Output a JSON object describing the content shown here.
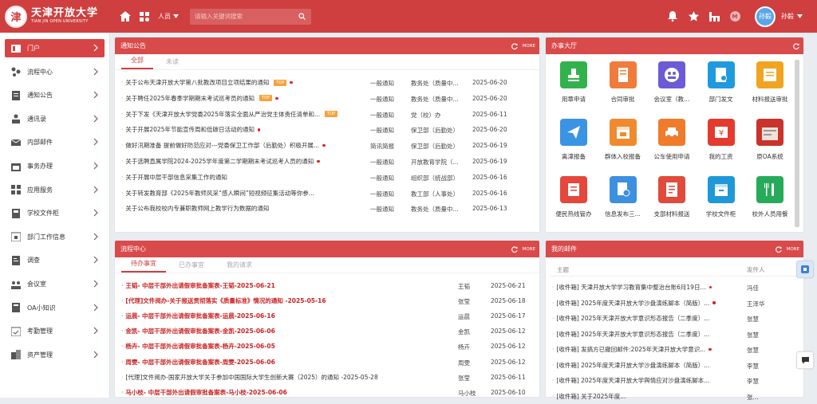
{
  "brand": {
    "title_cn": "天津开放大学",
    "title_en": "TIAN JIN OPEN UNIVERSITY",
    "seal": "津"
  },
  "search": {
    "scope": "人员",
    "placeholder": "请输入关键词搜索"
  },
  "user": {
    "avatar_text": "孙毅",
    "name": "孙毅"
  },
  "topbar_badge": "M",
  "colors": {
    "primary": "#cf3f3f",
    "panel_head": "#d94a4a",
    "badge": "#f7a23b"
  },
  "sidebar": {
    "items": [
      {
        "label": "门户",
        "icon": "portal-icon"
      },
      {
        "label": "流程中心",
        "icon": "flow-icon"
      },
      {
        "label": "通知公告",
        "icon": "notice-icon"
      },
      {
        "label": "通讯录",
        "icon": "contacts-icon"
      },
      {
        "label": "内部邮件",
        "icon": "mail-icon"
      },
      {
        "label": "事务办理",
        "icon": "calendar-icon"
      },
      {
        "label": "应用服务",
        "icon": "apps-icon"
      },
      {
        "label": "学校文件柜",
        "icon": "cabinet-icon"
      },
      {
        "label": "部门工作信息",
        "icon": "dept-calendar-icon"
      },
      {
        "label": "调查",
        "icon": "survey-icon"
      },
      {
        "label": "会议室",
        "icon": "meeting-icon"
      },
      {
        "label": "OA小知识",
        "icon": "knowledge-icon"
      },
      {
        "label": "考勤管理",
        "icon": "attendance-icon"
      },
      {
        "label": "资产管理",
        "icon": "asset-icon"
      }
    ]
  },
  "notice": {
    "title": "通知公告",
    "more": "MORE",
    "tabs": [
      "全部",
      "未读"
    ],
    "rows": [
      {
        "title": "关于公布天津开放大学第八批教改项目立项结果的通知",
        "top": true,
        "dot": true,
        "type": "一般通知",
        "dept": "教务处（质量中...",
        "date": "2025-06-20"
      },
      {
        "title": "关于聘任2025年春季学期期末考试巡考员的通知",
        "top": true,
        "dot": true,
        "type": "一般通知",
        "dept": "教务处（质量中...",
        "date": "2025-06-20"
      },
      {
        "title": "关于下发《天津开放大学党委2025年落实全面从严治党主体责任清单和...",
        "top": true,
        "dot": false,
        "type": "一般通知",
        "dept": "党（校）办",
        "date": "2025-06-11"
      },
      {
        "title": "关于开展2025年节能宣传周和低碳日活动的通知",
        "top": false,
        "dot": true,
        "type": "一般通知",
        "dept": "保卫部（后勤处）",
        "date": "2025-06-20"
      },
      {
        "title": "做好汛期准备 提前做好防范应对---党委保卫工作部（后勤处）积极开展...",
        "top": false,
        "dot": true,
        "type": "简讯简报",
        "dept": "保卫部（后勤处）",
        "date": "2025-06-19"
      },
      {
        "title": "关于选聘直属学院2024-2025学年度第二学期期末考试巡考人员的通知",
        "top": false,
        "dot": true,
        "type": "一般通知",
        "dept": "开放教育学院（...",
        "date": "2025-06-19"
      },
      {
        "title": "关于开展中层干部信息采集工作的通知",
        "top": false,
        "dot": false,
        "type": "一般通知",
        "dept": "组织部（统战部）",
        "date": "2025-06-16"
      },
      {
        "title": "关于转发教育部《2025年教师风采“感人瞬间”短视频征集活动等你参...",
        "top": false,
        "dot": false,
        "type": "一般通知",
        "dept": "教工部（人事处）",
        "date": "2025-06-16"
      },
      {
        "title": "关于公布我校校内专兼职教师网上教学行为数据的通知",
        "top": false,
        "dot": false,
        "type": "一般通知",
        "dept": "教务处（质量中...",
        "date": "2025-06-13"
      }
    ]
  },
  "services": {
    "title": "办事大厅",
    "items": [
      {
        "label": "用章申请",
        "icon": "stamp-icon",
        "color": "#31b24c"
      },
      {
        "label": "合同审批",
        "icon": "contract-icon",
        "color": "#f07b3a"
      },
      {
        "label": "会议室（教...",
        "icon": "meeting-room-icon",
        "color": "#6b5bd6"
      },
      {
        "label": "部门发文",
        "icon": "dept-doc-icon",
        "color": "#1f9ae0"
      },
      {
        "label": "材料报送审批",
        "icon": "material-submit-icon",
        "color": "#f0a41f"
      },
      {
        "label": "离津报备",
        "icon": "send-icon",
        "color": "#3b93e4"
      },
      {
        "label": "群体入校报备",
        "icon": "group-calendar-icon",
        "color": "#ef8a2e"
      },
      {
        "label": "公车使用申请",
        "icon": "car-icon",
        "color": "#ef7b2b"
      },
      {
        "label": "我的工资",
        "icon": "salary-icon",
        "color": "#e53b2f"
      },
      {
        "label": "原OA系统",
        "icon": "old-oa-icon",
        "color": "#c8332b"
      },
      {
        "label": "便民热线管办",
        "icon": "hotline-icon",
        "color": "#e5473c"
      },
      {
        "label": "信息发布三...",
        "icon": "info-publish-icon",
        "color": "#3d8fe0"
      },
      {
        "label": "支部材料报送",
        "icon": "branch-material-icon",
        "color": "#e04b3b"
      },
      {
        "label": "学校文件柜",
        "icon": "file-cabinet-icon",
        "color": "#1e98d8"
      },
      {
        "label": "校外人员用餐",
        "icon": "dining-icon",
        "color": "#27ab5a"
      }
    ]
  },
  "flow": {
    "title": "流程中心",
    "more": "MORE",
    "tabs": [
      "待办事宜",
      "已办事宜",
      "我的请求"
    ],
    "rows": [
      {
        "title": "王韬- 中层干部外出请假审批备案表-王韬-2025-06-21",
        "red": true,
        "person": "王韬",
        "date": "2025-06-21"
      },
      {
        "title": "[代理]文件阅办-关于报送贯彻落实《质量标准》情况的通知 -2025-05-16",
        "red": true,
        "person": "张莹",
        "date": "2025-06-18"
      },
      {
        "title": "运晨- 中层干部外出请假审批备案表-运晨-2025-06-16",
        "red": true,
        "person": "运晨",
        "date": "2025-06-17"
      },
      {
        "title": "金凯- 中层干部外出请假审批备案表-金凯-2025-06-06",
        "red": true,
        "person": "金凯",
        "date": "2025-06-12"
      },
      {
        "title": "杨卉- 中层干部外出请假审批备案表-杨卉-2025-06-05",
        "red": true,
        "person": "杨卉",
        "date": "2025-06-12"
      },
      {
        "title": "周雯- 中层干部外出请假审批备案表-周雯-2025-06-06",
        "red": true,
        "person": "周雯",
        "date": "2025-06-12"
      },
      {
        "title": "[代理]文件阅办-国家开放大学关于参加中国国际大学生创新大赛（2025）的通知 -2025-05-28",
        "red": false,
        "person": "张莹",
        "date": "2025-06-11"
      },
      {
        "title": "马小枝- 中层干部外出请假审批备案表-马小枝-2025-06-06",
        "red": true,
        "person": "马小枝",
        "date": "2025-06-10"
      }
    ]
  },
  "mail": {
    "title": "我的邮件",
    "more": "MORE",
    "col_subject": "主题",
    "col_sender": "发件人",
    "rows": [
      {
        "subject": "[收件箱] 天津开放大学学习教育集中整治台账6月19日...",
        "dot": true,
        "sender": "冯佳"
      },
      {
        "subject": "[收件箱] 2025年度天津开放大学沙盘演练脚本（简版）...",
        "dot": true,
        "sender": "王泽华"
      },
      {
        "subject": "[收件箱] 2025年天津开放大学意识形态报告（二季度）...",
        "dot": false,
        "sender": "张慧"
      },
      {
        "subject": "[收件箱] 2025年天津开放大学意识形态报告（二季度）...",
        "dot": false,
        "sender": "张慧"
      },
      {
        "subject": "[收件箱] 发搞方已撤回邮件:2025年天津开放大学意识...",
        "dot": true,
        "sender": "张慧"
      },
      {
        "subject": "[收件箱] 2025年度天津开放大学沙盘演练脚本（简版）...",
        "dot": false,
        "sender": "李慧"
      },
      {
        "subject": "[收件箱] 2025年度天津开放大学舆情应对沙盘演练脚本...",
        "dot": false,
        "sender": "李慧"
      },
      {
        "subject": "[收件箱] 关于2025年度...",
        "dot": false,
        "sender": "张..."
      }
    ]
  }
}
